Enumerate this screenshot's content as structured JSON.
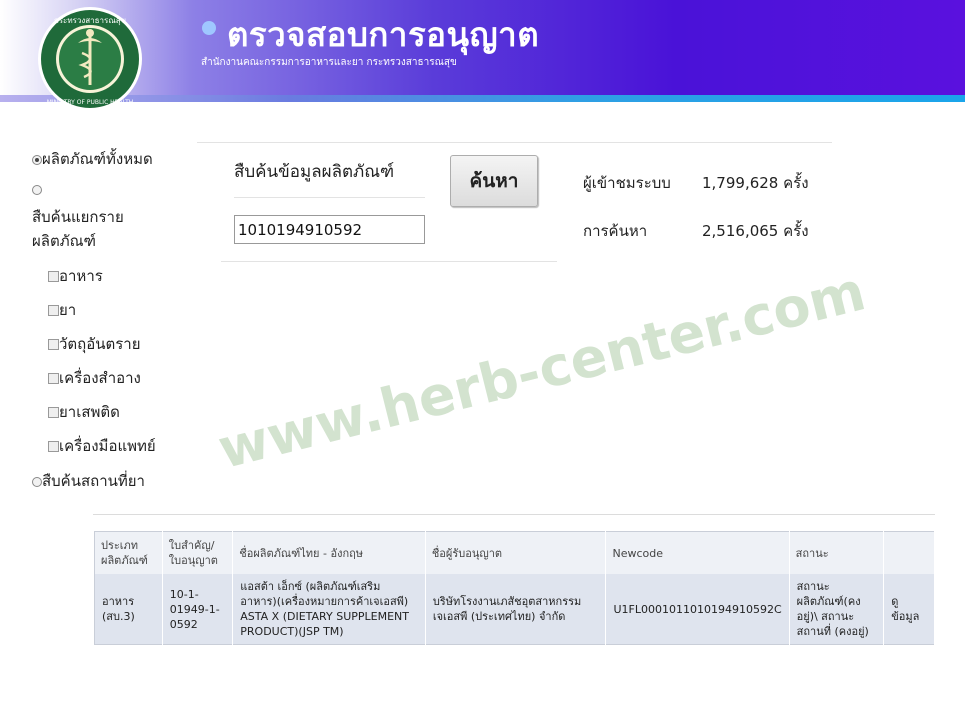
{
  "header": {
    "title": "ตรวจสอบการอนุญาต",
    "subtitle": "สำนักงานคณะกรรมการอาหารและยา กระทรวงสาธารณสุข",
    "logo": {
      "top_text": "กระทรวงสาธารณสุข",
      "bottom_text": "MINISTRY OF PUBLIC HEALTH"
    }
  },
  "sidebar": {
    "all_products": "ผลิตภัณฑ์ทั้งหมด",
    "by_category_line1": "สืบค้นแยกราย",
    "by_category_line2": "ผลิตภัณฑ์",
    "categories": [
      "อาหาร",
      "ยา",
      "วัตถุอันตราย",
      "เครื่องสำอาง",
      "ยาเสพติด",
      "เครื่องมือแพทย์"
    ],
    "by_location": "สืบค้นสถานที่ยา"
  },
  "search": {
    "label": "สืบค้นข้อมูลผลิตภัณฑ์",
    "value": "1010194910592",
    "button": "ค้นหา"
  },
  "stats": {
    "visitors_label": "ผู้เข้าชมระบบ",
    "visitors_value": "1,799,628 ครั้ง",
    "searches_label": "การค้นหา",
    "searches_value": "2,516,065 ครั้ง"
  },
  "watermark": "www.herb-center.com",
  "table": {
    "headers": {
      "type_l1": "ประเภท",
      "type_l2": "ผลิตภัณฑ์",
      "license_l1": "ใบสำคัญ/",
      "license_l2": "ใบอนุญาต",
      "name": "ชื่อผลิตภัณฑ์ไทย - อังกฤษ",
      "licensee": "ชื่อผู้รับอนุญาต",
      "newcode": "Newcode",
      "status": "สถานะ"
    },
    "row": {
      "type_l1": "อาหาร",
      "type_l2": "(สบ.3)",
      "license_l1": "10-1-",
      "license_l2": "01949-1-",
      "license_l3": "0592",
      "name_l1": "แอสต้า เอ็กซ์ (ผลิตภัณฑ์เสริม",
      "name_l2": "อาหาร)(เครื่องหมายการค้าเจเอสพี)",
      "name_l3": "ASTA X (DIETARY SUPPLEMENT",
      "name_l4": "PRODUCT)(JSP TM)",
      "licensee_l1": "บริษัทโรงงานเภสัชอุตสาหกรรม",
      "licensee_l2": "เจเอสพี (ประเทศไทย) จำกัด",
      "newcode": "U1FL0001011010194910592C",
      "status_l1": "สถานะ",
      "status_l2": "ผลิตภัณฑ์(คง",
      "status_l3": "อยู่)\\ สถานะ",
      "status_l4": "สถานที่ (คงอยู่)",
      "view_l1": "ดู",
      "view_l2": "ข้อมูล"
    }
  }
}
